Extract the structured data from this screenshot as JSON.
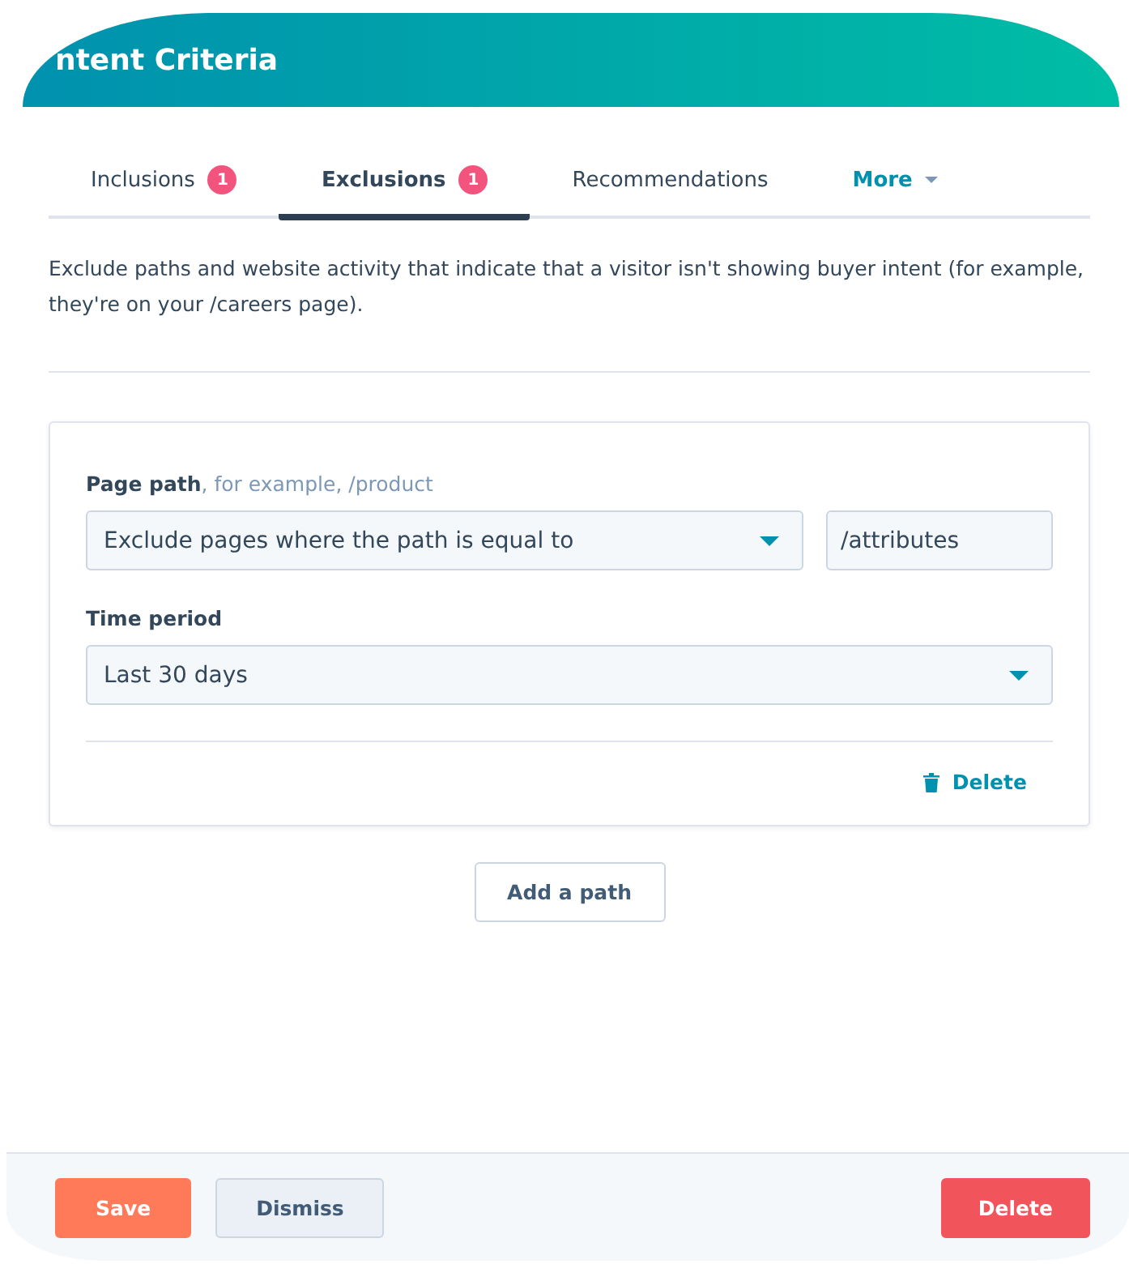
{
  "header": {
    "title": "ntent Criteria"
  },
  "tabs": [
    {
      "label": "Inclusions",
      "badge": "1",
      "selected": false,
      "kind": "tab"
    },
    {
      "label": "Exclusions",
      "badge": "1",
      "selected": true,
      "kind": "tab"
    },
    {
      "label": "Recommendations",
      "selected": false,
      "kind": "tab"
    },
    {
      "label": "More",
      "selected": false,
      "kind": "menu"
    }
  ],
  "description": "Exclude paths and website activity that indicate that a visitor isn't showing buyer intent (for example, they're on your /careers page).",
  "card": {
    "path_label": "Page path",
    "path_hint": ", for example, /product",
    "rule_value": "Exclude pages where the path is equal to",
    "path_value": "/attributes",
    "time_label": "Time period",
    "time_value": "Last 30 days",
    "delete": "Delete"
  },
  "add_button": "Add a path",
  "footer": {
    "save": "Save",
    "dismiss": "Dismiss",
    "delete": "Delete"
  }
}
